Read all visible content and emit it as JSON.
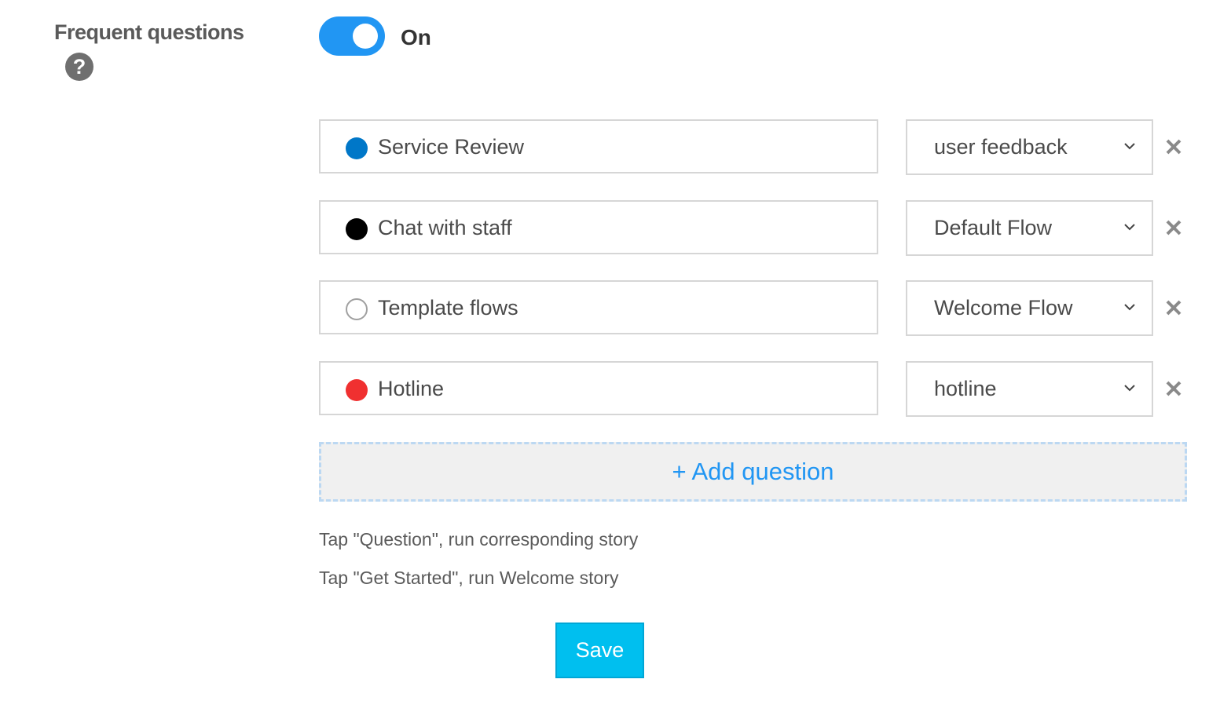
{
  "section": {
    "label": "Frequent questions",
    "help_glyph": "?",
    "help_icon": "question-circle-icon"
  },
  "toggle": {
    "state": "On",
    "color": "#2196f3"
  },
  "questions": [
    {
      "label": "Service Review",
      "dot_color": "#0077c8",
      "flow": "user feedback"
    },
    {
      "label": "Chat with staff",
      "dot_color": "#000000",
      "flow": "Default Flow"
    },
    {
      "label": "Template flows",
      "dot_color": "#ffffff",
      "flow": "Welcome Flow"
    },
    {
      "label": "Hotline",
      "dot_color": "#f03030",
      "flow": "hotline"
    }
  ],
  "add_question_label": "+ Add question",
  "hints": [
    "Tap \"Question\", run corresponding story",
    "Tap \"Get Started\", run Welcome story"
  ],
  "save_label": "Save",
  "icons": {
    "remove": "close-x-icon",
    "dropdown": "chevron-down-icon"
  }
}
